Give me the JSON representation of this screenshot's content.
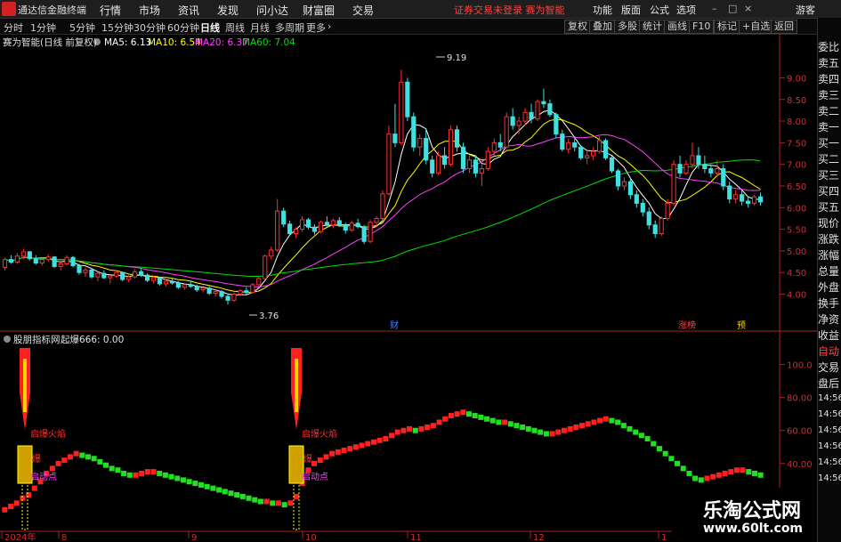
{
  "app": {
    "title": "通达信金融终端",
    "menu": [
      "行情",
      "市场",
      "资讯",
      "发现",
      "问小达",
      "财富圈",
      "交易"
    ],
    "login_status": "证券交易未登录 赛为智能",
    "right_menu": [
      "功能",
      "版面",
      "公式",
      "选项"
    ],
    "guest_label": "游客",
    "window_controls": [
      "–",
      "□",
      "×"
    ]
  },
  "toolbar": {
    "periods": [
      "分时",
      "1分钟",
      "5分钟",
      "15分钟",
      "30分钟",
      "60分钟",
      "日线",
      "周线",
      "月线",
      "多周期",
      "更多"
    ],
    "active_period": "日线",
    "more_suffix": "›",
    "buttons": [
      "复权",
      "叠加",
      "多股",
      "统计",
      "画线",
      "F10",
      "标记",
      "+自选",
      "返回"
    ],
    "r_badge": "R"
  },
  "sidebar": {
    "items": [
      "委比",
      "卖五",
      "卖四",
      "卖三",
      "卖二",
      "卖一",
      "买一",
      "买二",
      "买三",
      "买四",
      "买五",
      "现价",
      "涨跌",
      "涨幅",
      "总量",
      "外盘",
      "换手",
      "净资",
      "收益",
      "自动",
      "交易",
      "盘后"
    ],
    "times": [
      "14:56",
      "14:56",
      "14:56",
      "14:56",
      "14:56",
      "14:56"
    ]
  },
  "main_chart": {
    "stock_label": "赛为智能(日线 前复权)",
    "ma_legend": [
      {
        "label": "MA5: 6.13",
        "color": "#ffffff"
      },
      {
        "label": "MA10: 6.54",
        "color": "#ffff00"
      },
      {
        "label": "MA20: 6.37",
        "color": "#ff40ff"
      },
      {
        "label": "MA60: 7.04",
        "color": "#00e000"
      }
    ],
    "y_ticks": [
      "9.00",
      "8.50",
      "8.00",
      "7.50",
      "7.00",
      "6.50",
      "6.00",
      "5.50",
      "5.00",
      "4.50",
      "4.00"
    ],
    "high_label": "9.19",
    "low_label": "3.76",
    "markers": [
      {
        "label": "财",
        "color": "#4080ff"
      },
      {
        "label": "涨榜",
        "color": "#ff4040"
      },
      {
        "label": "预",
        "color": "#ffcc00"
      }
    ]
  },
  "indicator": {
    "name": "股朋指标网",
    "formula": "起爆666: 0.00",
    "y_ticks": [
      "100.0",
      "80.00",
      "60.00",
      "40.00"
    ],
    "annotations": [
      {
        "fire": "启爆火焰",
        "start": "启动点",
        "short": "爆"
      },
      {
        "fire": "启爆火焰",
        "start": "启动点",
        "short": "爆"
      }
    ]
  },
  "x_axis": [
    "2024年",
    "8",
    "9",
    "10",
    "11",
    "12",
    "1"
  ],
  "watermark": {
    "cn": "乐淘公式网",
    "url": "www.60lt.com"
  },
  "colors": {
    "up": "#ff3030",
    "down": "#40e0e0",
    "ind_up": "#ff2020",
    "ind_down": "#20e020",
    "ma60": "#00e000"
  },
  "chart_data": {
    "type": "candlestick",
    "ylim": [
      3.6,
      9.4
    ],
    "candles": [
      [
        4.62,
        4.85,
        4.55,
        4.8
      ],
      [
        4.8,
        4.9,
        4.7,
        4.74
      ],
      [
        4.74,
        4.95,
        4.7,
        4.88
      ],
      [
        4.88,
        5.05,
        4.8,
        4.98
      ],
      [
        4.98,
        5.0,
        4.78,
        4.82
      ],
      [
        4.82,
        4.9,
        4.68,
        4.72
      ],
      [
        4.72,
        4.85,
        4.66,
        4.8
      ],
      [
        4.8,
        4.92,
        4.75,
        4.86
      ],
      [
        4.86,
        4.88,
        4.6,
        4.64
      ],
      [
        4.64,
        4.75,
        4.55,
        4.7
      ],
      [
        4.7,
        4.9,
        4.66,
        4.85
      ],
      [
        4.85,
        4.88,
        4.62,
        4.66
      ],
      [
        4.66,
        4.7,
        4.45,
        4.5
      ],
      [
        4.5,
        4.62,
        4.4,
        4.56
      ],
      [
        4.56,
        4.6,
        4.36,
        4.4
      ],
      [
        4.4,
        4.52,
        4.3,
        4.48
      ],
      [
        4.48,
        4.55,
        4.35,
        4.38
      ],
      [
        4.38,
        4.46,
        4.25,
        4.42
      ],
      [
        4.42,
        4.56,
        4.38,
        4.5
      ],
      [
        4.5,
        4.52,
        4.3,
        4.34
      ],
      [
        4.34,
        4.44,
        4.28,
        4.4
      ],
      [
        4.4,
        4.58,
        4.36,
        4.52
      ],
      [
        4.52,
        4.6,
        4.4,
        4.44
      ],
      [
        4.44,
        4.48,
        4.28,
        4.32
      ],
      [
        4.32,
        4.42,
        4.25,
        4.38
      ],
      [
        4.38,
        4.4,
        4.2,
        4.24
      ],
      [
        4.24,
        4.34,
        4.18,
        4.3
      ],
      [
        4.3,
        4.38,
        4.22,
        4.26
      ],
      [
        4.26,
        4.3,
        4.12,
        4.16
      ],
      [
        4.16,
        4.26,
        4.1,
        4.22
      ],
      [
        4.22,
        4.3,
        4.14,
        4.18
      ],
      [
        4.18,
        4.22,
        4.05,
        4.1
      ],
      [
        4.1,
        4.2,
        4.04,
        4.14
      ],
      [
        4.14,
        4.18,
        3.98,
        4.02
      ],
      [
        4.02,
        4.1,
        3.94,
        4.06
      ],
      [
        4.06,
        4.1,
        3.9,
        3.95
      ],
      [
        3.95,
        4.02,
        3.76,
        3.86
      ],
      [
        3.86,
        4.04,
        3.82,
        4.0
      ],
      [
        4.0,
        4.12,
        3.96,
        4.08
      ],
      [
        4.08,
        4.16,
        4.0,
        4.04
      ],
      [
        4.04,
        4.26,
        4.02,
        4.22
      ],
      [
        4.22,
        4.4,
        4.18,
        4.36
      ],
      [
        4.36,
        4.92,
        4.34,
        4.88
      ],
      [
        4.88,
        5.1,
        4.8,
        5.02
      ],
      [
        5.02,
        6.2,
        4.98,
        5.92
      ],
      [
        5.92,
        6.0,
        5.55,
        5.62
      ],
      [
        5.62,
        5.7,
        5.35,
        5.4
      ],
      [
        5.4,
        5.55,
        5.3,
        5.5
      ],
      [
        5.5,
        5.8,
        5.44,
        5.72
      ],
      [
        5.72,
        5.76,
        5.5,
        5.55
      ],
      [
        5.55,
        5.62,
        5.38,
        5.45
      ],
      [
        5.45,
        5.7,
        5.4,
        5.66
      ],
      [
        5.66,
        5.8,
        5.56,
        5.6
      ],
      [
        5.6,
        5.75,
        5.52,
        5.7
      ],
      [
        5.7,
        5.78,
        5.55,
        5.6
      ],
      [
        5.6,
        5.65,
        5.4,
        5.48
      ],
      [
        5.48,
        5.7,
        5.44,
        5.64
      ],
      [
        5.64,
        5.74,
        5.52,
        5.56
      ],
      [
        5.56,
        5.6,
        5.16,
        5.22
      ],
      [
        5.22,
        5.72,
        5.18,
        5.66
      ],
      [
        5.66,
        5.8,
        5.55,
        5.75
      ],
      [
        5.75,
        6.4,
        5.7,
        6.32
      ],
      [
        6.32,
        7.9,
        6.28,
        7.7
      ],
      [
        7.7,
        8.4,
        7.4,
        7.5
      ],
      [
        7.5,
        9.19,
        7.45,
        8.9
      ],
      [
        8.9,
        9.0,
        8.0,
        8.1
      ],
      [
        8.1,
        8.2,
        7.3,
        7.4
      ],
      [
        7.4,
        7.7,
        7.2,
        7.6
      ],
      [
        7.6,
        7.8,
        7.0,
        7.1
      ],
      [
        7.1,
        7.2,
        6.7,
        6.8
      ],
      [
        6.8,
        7.3,
        6.75,
        7.2
      ],
      [
        7.2,
        7.4,
        6.9,
        7.0
      ],
      [
        7.0,
        7.9,
        6.95,
        7.8
      ],
      [
        7.8,
        7.9,
        7.3,
        7.4
      ],
      [
        7.4,
        7.5,
        6.8,
        6.9
      ],
      [
        6.9,
        7.2,
        6.8,
        7.1
      ],
      [
        7.1,
        7.2,
        6.7,
        6.8
      ],
      [
        6.8,
        7.0,
        6.5,
        6.9
      ],
      [
        6.9,
        7.4,
        6.85,
        7.3
      ],
      [
        7.3,
        7.6,
        7.2,
        7.5
      ],
      [
        7.5,
        7.7,
        7.3,
        7.4
      ],
      [
        7.4,
        8.2,
        7.35,
        8.1
      ],
      [
        8.1,
        8.3,
        7.8,
        7.9
      ],
      [
        7.9,
        8.1,
        7.7,
        8.0
      ],
      [
        8.0,
        8.3,
        7.9,
        8.2
      ],
      [
        8.2,
        8.4,
        7.95,
        8.05
      ],
      [
        8.05,
        8.5,
        8.0,
        8.45
      ],
      [
        8.45,
        8.75,
        8.3,
        8.4
      ],
      [
        8.4,
        8.5,
        8.1,
        8.15
      ],
      [
        8.15,
        8.2,
        7.6,
        7.7
      ],
      [
        7.7,
        7.8,
        7.3,
        7.35
      ],
      [
        7.35,
        7.6,
        7.25,
        7.5
      ],
      [
        7.5,
        7.65,
        7.3,
        7.4
      ],
      [
        7.4,
        7.45,
        7.1,
        7.15
      ],
      [
        7.15,
        7.3,
        7.0,
        7.2
      ],
      [
        7.2,
        7.4,
        7.1,
        7.3
      ],
      [
        7.3,
        7.65,
        7.25,
        7.55
      ],
      [
        7.55,
        7.6,
        7.1,
        7.15
      ],
      [
        7.15,
        7.2,
        6.8,
        6.85
      ],
      [
        6.85,
        6.9,
        6.4,
        6.5
      ],
      [
        6.5,
        6.7,
        6.4,
        6.6
      ],
      [
        6.6,
        6.7,
        6.2,
        6.3
      ],
      [
        6.3,
        6.4,
        6.0,
        6.1
      ],
      [
        6.1,
        6.2,
        5.8,
        5.9
      ],
      [
        5.9,
        6.0,
        5.5,
        5.6
      ],
      [
        5.6,
        5.7,
        5.3,
        5.4
      ],
      [
        5.4,
        5.8,
        5.35,
        5.75
      ],
      [
        5.75,
        6.2,
        5.7,
        6.1
      ],
      [
        6.1,
        7.1,
        6.05,
        7.0
      ],
      [
        7.0,
        7.2,
        6.7,
        6.8
      ],
      [
        6.8,
        7.1,
        6.75,
        7.0
      ],
      [
        7.0,
        7.5,
        6.9,
        7.2
      ],
      [
        7.2,
        7.4,
        6.9,
        7.0
      ],
      [
        7.0,
        7.2,
        6.8,
        6.9
      ],
      [
        6.9,
        7.0,
        6.7,
        6.8
      ],
      [
        6.8,
        7.1,
        6.7,
        6.9
      ],
      [
        6.9,
        7.0,
        6.4,
        6.5
      ],
      [
        6.5,
        6.6,
        6.1,
        6.2
      ],
      [
        6.2,
        6.4,
        6.1,
        6.3
      ],
      [
        6.3,
        6.4,
        6.05,
        6.15
      ],
      [
        6.15,
        6.25,
        6.0,
        6.1
      ],
      [
        6.1,
        6.3,
        6.05,
        6.25
      ],
      [
        6.25,
        6.35,
        6.05,
        6.13
      ]
    ],
    "ma5_last": 6.13,
    "ma10_last": 6.54,
    "ma20_last": 6.37,
    "ma60_last": 7.04,
    "indicator_values": [
      12,
      14,
      16,
      19,
      21,
      25,
      29,
      34,
      37,
      40,
      42,
      44,
      46,
      45,
      44,
      43,
      41,
      39,
      37,
      36,
      34,
      33,
      33,
      34,
      35,
      35,
      34,
      33,
      32,
      31,
      30,
      29,
      28,
      27,
      26,
      25,
      24,
      23,
      22,
      21,
      20,
      19,
      18,
      17,
      17,
      16,
      16,
      15,
      16,
      20,
      28,
      36,
      40,
      42,
      44,
      46,
      47,
      48,
      49,
      50,
      51,
      52,
      53,
      54,
      55,
      57,
      59,
      60,
      61,
      60,
      61,
      62,
      63,
      65,
      67,
      69,
      70,
      71,
      70,
      69,
      68,
      67,
      66,
      65,
      65,
      64,
      63,
      62,
      61,
      60,
      59,
      58,
      58,
      59,
      60,
      61,
      62,
      63,
      64,
      65,
      66,
      67,
      66,
      65,
      63,
      61,
      59,
      57,
      55,
      52,
      49,
      46,
      43,
      40,
      37,
      34,
      31,
      30,
      31,
      32,
      33,
      34,
      35,
      36,
      36,
      35,
      34,
      33
    ]
  }
}
